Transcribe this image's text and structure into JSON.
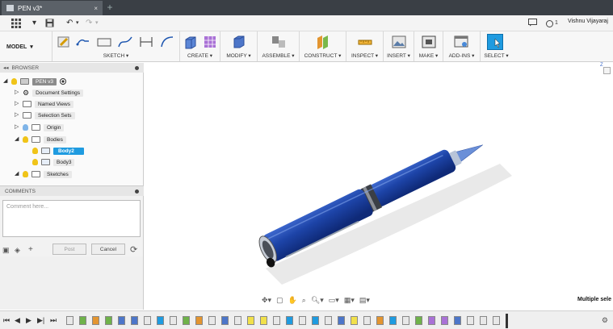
{
  "window": {
    "tab_title": "PEN v3*",
    "close_glyph": "×",
    "new_tab_glyph": "+"
  },
  "quick_access": {
    "icons": [
      "grid-icon",
      "save-icon",
      "undo-icon",
      "redo-icon"
    ],
    "job_status": "1",
    "user_name": "Vishnu Vijayaraj"
  },
  "toolbar": {
    "workspace": "MODEL",
    "groups": [
      {
        "label": "SKETCH ▾"
      },
      {
        "label": "CREATE ▾"
      },
      {
        "label": "MODIFY ▾"
      },
      {
        "label": "ASSEMBLE ▾"
      },
      {
        "label": "CONSTRUCT ▾"
      },
      {
        "label": "INSPECT ▾"
      },
      {
        "label": "INSERT ▾"
      },
      {
        "label": "MAKE ▾"
      },
      {
        "label": "ADD-INS ▾"
      },
      {
        "label": "SELECT ▾"
      }
    ]
  },
  "browser": {
    "title": "BROWSER",
    "items": [
      {
        "label": "PEN v3"
      },
      {
        "label": "Document Settings"
      },
      {
        "label": "Named Views"
      },
      {
        "label": "Selection Sets"
      },
      {
        "label": "Origin"
      },
      {
        "label": "Bodies"
      },
      {
        "label": "Body2"
      },
      {
        "label": "Body3"
      },
      {
        "label": "Sketches"
      }
    ]
  },
  "comments": {
    "title": "COMMENTS",
    "placeholder": "Comment here...",
    "post_label": "Post",
    "cancel_label": "Cancel"
  },
  "status": {
    "selection_text": "Multiple sele"
  },
  "viewcube": {
    "axis_label": "Z"
  },
  "colors": {
    "accent": "#1f9be0",
    "pen_body": "#1d44a8",
    "title_bar": "#3a3f45"
  }
}
